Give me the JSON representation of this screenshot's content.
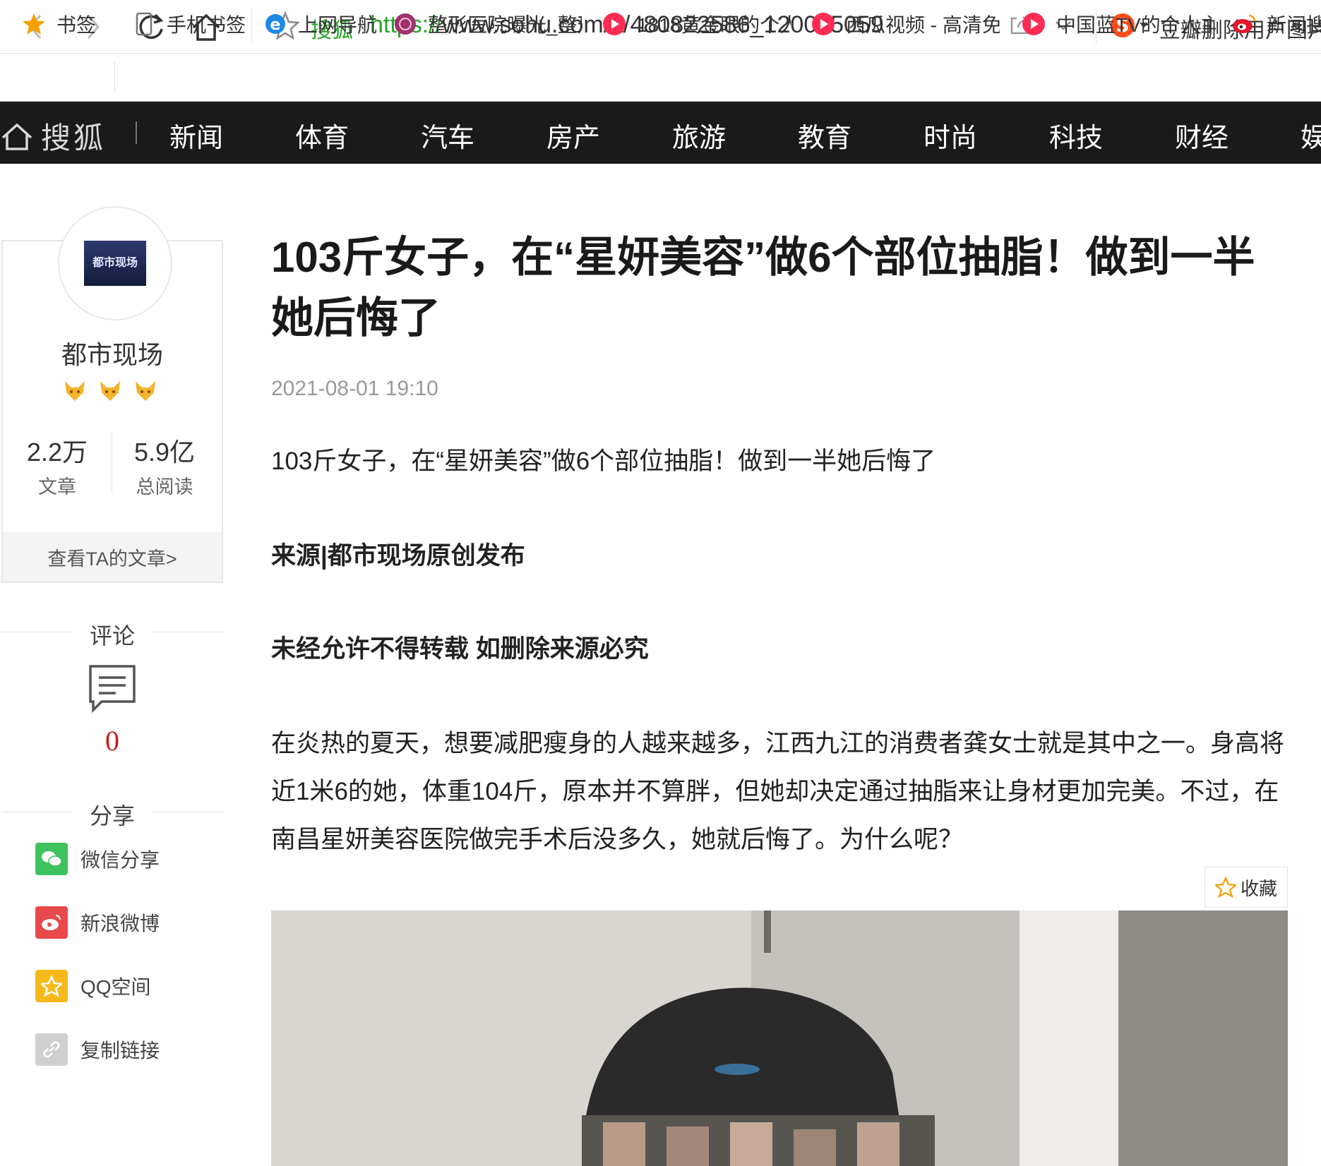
{
  "browser": {
    "site_name": "搜狐",
    "url_proto": "https://",
    "url_rest": "www.sohu.com/a/480822586_120045059",
    "search_text": "豆瓣删除用户图片"
  },
  "bookmarks": [
    {
      "label": "书签",
      "icon": "star-icon"
    },
    {
      "label": "手机书签",
      "icon": "phone-icon"
    },
    {
      "label": "上网导航",
      "icon": "ie-icon"
    },
    {
      "label": "整形医院曝光_整形",
      "icon": "hospital-icon"
    },
    {
      "label": "1818黄金眼的个人",
      "icon": "video-icon"
    },
    {
      "label": "西瓜视频 - 高清免",
      "icon": "video-icon"
    },
    {
      "label": "中国蓝TV的个人主",
      "icon": "video-icon"
    },
    {
      "label": "新闻搜",
      "icon": "weibo-icon"
    }
  ],
  "site_nav": {
    "logo": "搜狐",
    "items": [
      "新闻",
      "体育",
      "汽车",
      "房产",
      "旅游",
      "教育",
      "时尚",
      "科技",
      "财经",
      "娱"
    ]
  },
  "author": {
    "avatar_text": "都市现场",
    "name": "都市现场",
    "articles_count": "2.2万",
    "articles_label": "文章",
    "reads_count": "5.9亿",
    "reads_label": "总阅读",
    "view_articles": "查看TA的文章>"
  },
  "comments": {
    "title": "评论",
    "count": "0"
  },
  "share": {
    "title": "分享",
    "items": [
      {
        "label": "微信分享",
        "color": "#3cc35d"
      },
      {
        "label": "新浪微博",
        "color": "#e8494c"
      },
      {
        "label": "QQ空间",
        "color": "#f5b91b"
      },
      {
        "label": "复制链接",
        "color": "#cfcfcf"
      }
    ]
  },
  "article": {
    "title": "103斤女子，在“星妍美容”做6个部位抽脂！做到一半她后悔了",
    "timestamp": "2021-08-01 19:10",
    "intro": "103斤女子，在“星妍美容”做6个部位抽脂！做到一半她后悔了",
    "source": "来源|都市现场原创发布",
    "notice": "未经允许不得转载 如删除来源必究",
    "body": "在炎热的夏天，想要减肥瘦身的人越来越多，江西九江的消费者龚女士就是其中之一。身高将近1米6的她，体重104斤，原本并不算胖，但她却决定通过抽脂来让身材更加完美。不过，在南昌星妍美容医院做完手术后没多久，她就后悔了。为什么呢？",
    "collect_label": "收藏"
  }
}
